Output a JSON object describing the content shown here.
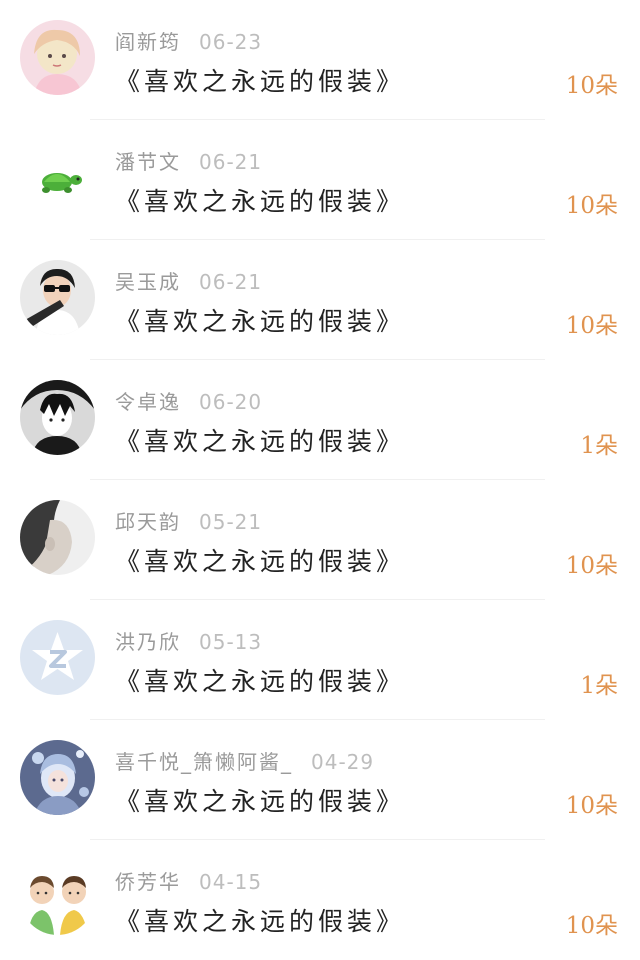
{
  "rows": [
    {
      "name": "阎新筠",
      "date": "06-23",
      "title": "《喜欢之永远的假装》",
      "amount": "10朵",
      "avatar_icon": "anime-girl-avatar"
    },
    {
      "name": "潘节文",
      "date": "06-21",
      "title": "《喜欢之永远的假装》",
      "amount": "10朵",
      "avatar_icon": "turtle-avatar"
    },
    {
      "name": "吴玉成",
      "date": "06-21",
      "title": "《喜欢之永远的假装》",
      "amount": "10朵",
      "avatar_icon": "sunglasses-person-avatar"
    },
    {
      "name": "令卓逸",
      "date": "06-20",
      "title": "《喜欢之永远的假装》",
      "amount": "1朵",
      "avatar_icon": "manga-boy-avatar"
    },
    {
      "name": "邱天韵",
      "date": "05-21",
      "title": "《喜欢之永远的假装》",
      "amount": "10朵",
      "avatar_icon": "side-profile-avatar"
    },
    {
      "name": "洪乃欣",
      "date": "05-13",
      "title": "《喜欢之永远的假装》",
      "amount": "1朵",
      "avatar_icon": "default-z-avatar"
    },
    {
      "name": "喜千悦_箫懒阿酱_",
      "date": "04-29",
      "title": "《喜欢之永远的假装》",
      "amount": "10朵",
      "avatar_icon": "fantasy-girl-avatar"
    },
    {
      "name": "侨芳华",
      "date": "04-15",
      "title": "《喜欢之永远的假装》",
      "amount": "10朵",
      "avatar_icon": "cartoon-couple-avatar"
    }
  ],
  "colors": {
    "name_text": "#9a9a9a",
    "date_text": "#bdbdbd",
    "title_text": "#222222",
    "amount_text": "#e0934f",
    "divider": "#f0f0f0"
  }
}
